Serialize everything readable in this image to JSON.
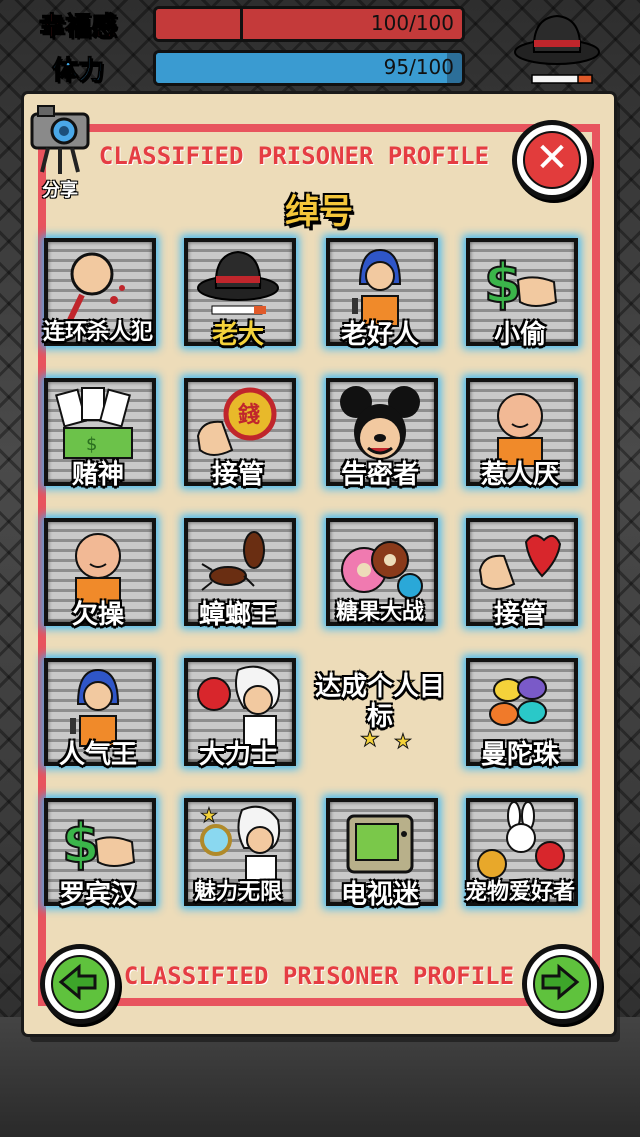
{
  "hud": {
    "happiness_label": "幸福感",
    "happiness_value": "100/100",
    "happiness_fraction": 1.0,
    "stamina_label": "体力",
    "stamina_value": "95/100",
    "stamina_fraction": 0.95,
    "colors": {
      "happiness": "#c43a3a",
      "stamina": "#3a9bd1",
      "happiness_label": "#d63b3b",
      "stamina_label": "#3fa7e6"
    }
  },
  "share": {
    "label": "分享",
    "icon": "camera-icon"
  },
  "panel": {
    "title": "CLASSIFIED PRISONER PROFILE",
    "footer": "CLASSIFIED PRISONER PROFILE",
    "section_title": "绰号",
    "close_icon": "close-icon",
    "prev_icon": "arrow-left-icon",
    "next_icon": "arrow-right-icon"
  },
  "nicknames": [
    {
      "label": "连环杀人犯",
      "icon": "bloody-fist-icon"
    },
    {
      "label": "老大",
      "icon": "fedora-hat-icon",
      "highlight": true
    },
    {
      "label": "老好人",
      "icon": "singer-girl-icon"
    },
    {
      "label": "小偷",
      "icon": "money-hand-icon"
    },
    {
      "label": "赌神",
      "icon": "cards-money-icon"
    },
    {
      "label": "接管",
      "icon": "fist-coin-icon"
    },
    {
      "label": "告密者",
      "icon": "mouse-face-icon"
    },
    {
      "label": "惹人厌",
      "icon": "bald-prisoner-icon"
    },
    {
      "label": "欠操",
      "icon": "bald-prisoner-icon"
    },
    {
      "label": "蟑螂王",
      "icon": "cockroach-icon"
    },
    {
      "label": "糖果大战",
      "icon": "donut-candy-icon"
    },
    {
      "label": "接管",
      "icon": "fist-heart-icon"
    },
    {
      "label": "人气王",
      "icon": "singer-girl-icon"
    },
    {
      "label": "大力士",
      "icon": "boxing-professor-icon"
    },
    {
      "label": "达成个人目标",
      "icon": "stars-icon",
      "two_line": true
    },
    {
      "label": "曼陀珠",
      "icon": "candy-balls-icon"
    },
    {
      "label": "罗宾汉",
      "icon": "money-hand-icon"
    },
    {
      "label": "魅力无限",
      "icon": "mirror-professor-icon"
    },
    {
      "label": "电视迷",
      "icon": "tv-icon"
    },
    {
      "label": "宠物爱好者",
      "icon": "pets-icon"
    }
  ]
}
